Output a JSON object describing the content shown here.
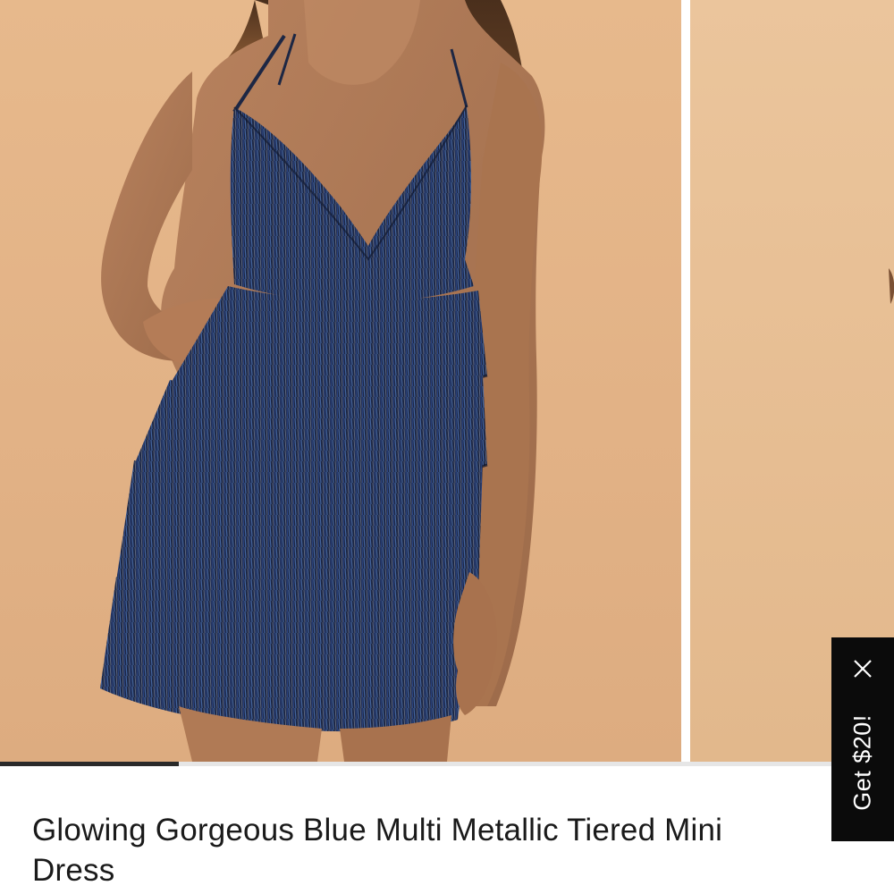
{
  "product": {
    "title": "Glowing Gorgeous Blue Multi Metallic Tiered Mini Dress"
  },
  "gallery": {
    "progress": 0.2,
    "progress_color": "#2a2a2a",
    "image_subject": "model wearing the dress"
  },
  "promo": {
    "label": "Get $20!",
    "close_icon": "close-icon"
  },
  "colors": {
    "dress": "#1e2a4a",
    "backdrop": "#e2b286",
    "promo_bg": "#0b0b0b"
  }
}
